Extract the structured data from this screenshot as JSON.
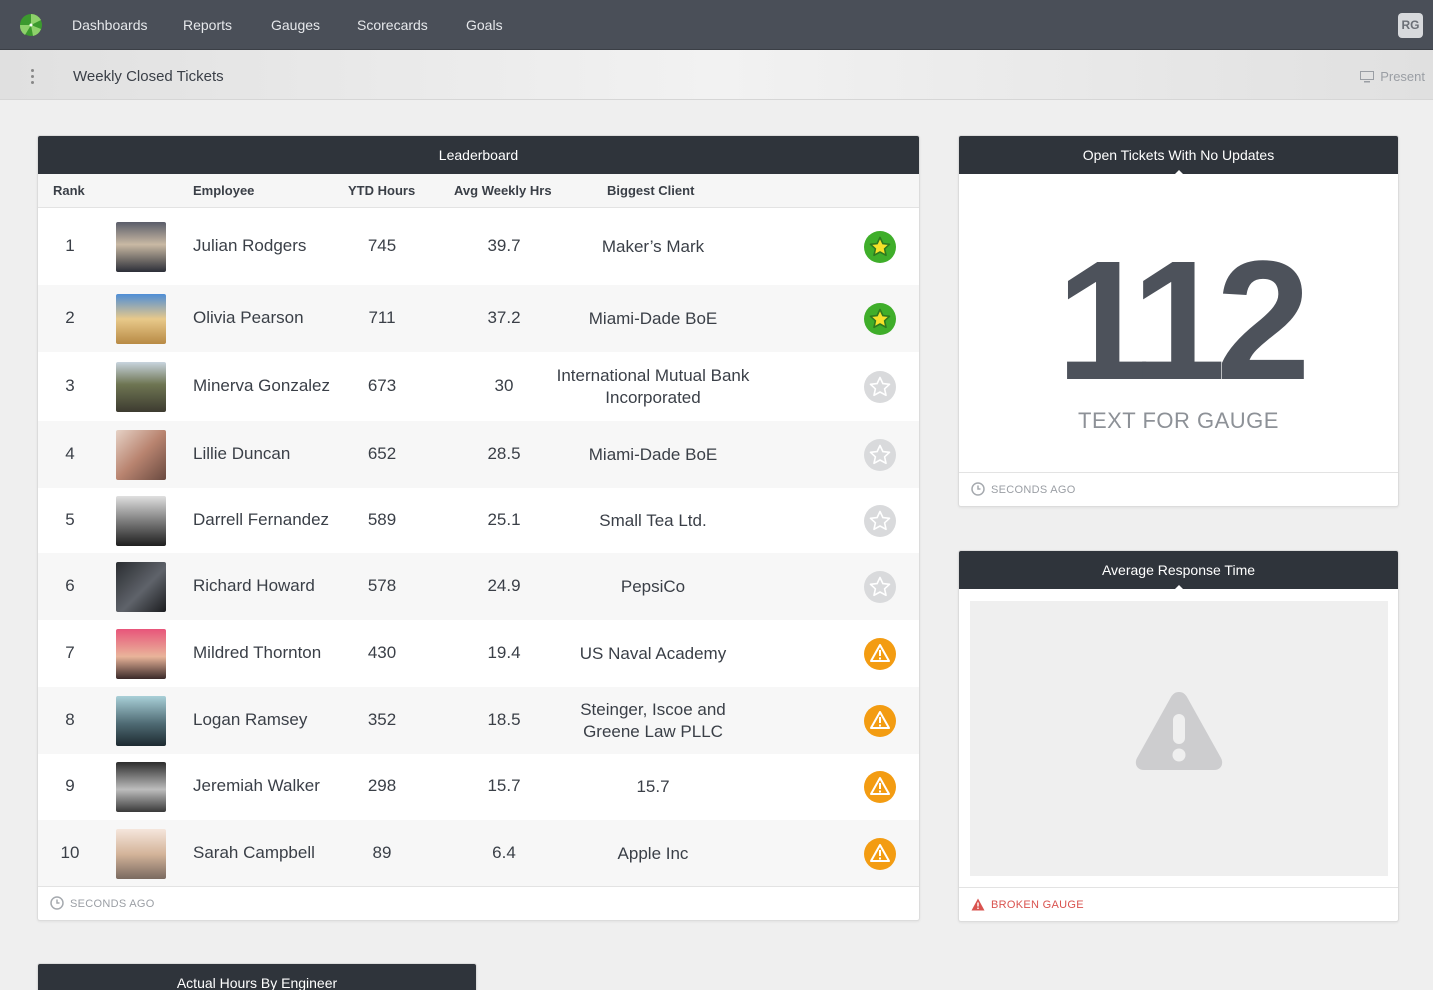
{
  "nav": {
    "items": [
      "Dashboards",
      "Reports",
      "Gauges",
      "Scorecards",
      "Goals"
    ],
    "user_initials": "RG"
  },
  "subbar": {
    "title": "Weekly Closed Tickets",
    "present_label": "Present"
  },
  "leaderboard": {
    "title": "Leaderboard",
    "columns": [
      "Rank",
      "Employee",
      "YTD Hours",
      "Avg Weekly Hrs",
      "Biggest Client"
    ],
    "rows": [
      {
        "rank": "1",
        "name": "Julian Rodgers",
        "ytd": "745",
        "avg": "39.7",
        "client": "Maker’s Mark",
        "status": "star-filled"
      },
      {
        "rank": "2",
        "name": "Olivia Pearson",
        "ytd": "711",
        "avg": "37.2",
        "client": "Miami-Dade BoE",
        "status": "star-filled"
      },
      {
        "rank": "3",
        "name": "Minerva Gonzalez",
        "ytd": "673",
        "avg": "30",
        "client": "International Mutual Bank Incorporated",
        "status": "star-empty"
      },
      {
        "rank": "4",
        "name": "Lillie Duncan",
        "ytd": "652",
        "avg": "28.5",
        "client": "Miami-Dade BoE",
        "status": "star-empty"
      },
      {
        "rank": "5",
        "name": "Darrell Fernandez",
        "ytd": "589",
        "avg": "25.1",
        "client": "Small Tea Ltd.",
        "status": "star-empty"
      },
      {
        "rank": "6",
        "name": "Richard Howard",
        "ytd": "578",
        "avg": "24.9",
        "client": "PepsiCo",
        "status": "star-empty"
      },
      {
        "rank": "7",
        "name": "Mildred Thornton",
        "ytd": "430",
        "avg": "19.4",
        "client": "US Naval Academy",
        "status": "warning"
      },
      {
        "rank": "8",
        "name": "Logan Ramsey",
        "ytd": "352",
        "avg": "18.5",
        "client": "Steinger, Iscoe and Greene Law PLLC",
        "status": "warning"
      },
      {
        "rank": "9",
        "name": "Jeremiah Walker",
        "ytd": "298",
        "avg": "15.7",
        "client": "15.7",
        "status": "warning"
      },
      {
        "rank": "10",
        "name": "Sarah Campbell",
        "ytd": "89",
        "avg": "6.4",
        "client": "Apple Inc",
        "status": "warning"
      }
    ],
    "footer": "SECONDS AGO"
  },
  "open_tickets": {
    "title": "Open Tickets With No Updates",
    "value": "112",
    "label": "TEXT FOR GAUGE",
    "footer": "SECONDS AGO"
  },
  "avg_response": {
    "title": "Average Response Time",
    "footer": "BROKEN GAUGE"
  },
  "actual_hours": {
    "title": "Actual Hours By Engineer"
  },
  "colors": {
    "nav_bg": "#4a4f58",
    "card_header": "#2f343b",
    "star_green": "#3fae2a",
    "warning_orange": "#f39c12",
    "error_red": "#d9534f"
  }
}
